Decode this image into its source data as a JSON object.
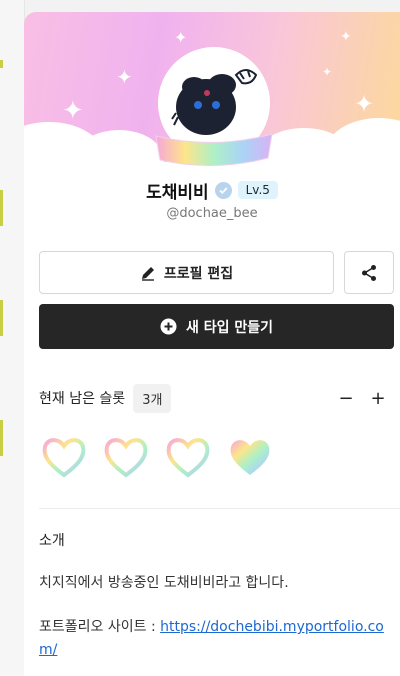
{
  "profile": {
    "name": "도채비비",
    "level": "Lv.5",
    "handle": "@dochae_bee"
  },
  "actions": {
    "edit_label": "프로필 편집",
    "new_label": "새 타입 만들기"
  },
  "slots": {
    "label": "현재 남은 슬롯",
    "count": "3개",
    "minus": "−",
    "plus": "+"
  },
  "about": {
    "heading": "소개",
    "text": "치지직에서 방송중인 도채비비라고 합니다.",
    "portfolio_label": "포트폴리오 사이트 : ",
    "portfolio_url": "https://dochebibi.myportfolio.com/"
  },
  "colors": {
    "primary_button": "#262626",
    "link": "#1d68d1",
    "level_badge_bg": "#def3fb"
  },
  "icons": {
    "edit": "pencil-icon",
    "share": "share-icon",
    "new": "plus-circle-icon",
    "verified": "check-badge-icon"
  }
}
